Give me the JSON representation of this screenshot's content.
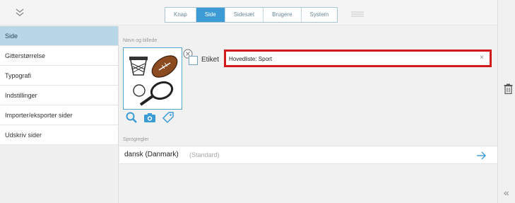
{
  "tabs": [
    "Knap",
    "Side",
    "Sidesæt",
    "Brugere",
    "System"
  ],
  "active_tab": "Side",
  "sidebar": {
    "items": [
      "Side",
      "Gitterstørrelse",
      "Typografi",
      "Indstillinger",
      "Importer/eksporter sider",
      "Udskriv sider"
    ],
    "active": "Side"
  },
  "main": {
    "name_image_label": "Navn og billede",
    "checkbox_label": "Etiket",
    "name_value": "Hovedliste: Sport",
    "language_label": "Sprogregler",
    "language_name": "dansk (Danmark)",
    "language_default": "(Standard)"
  },
  "icons": {
    "collapse": "double-chevron-down-icon",
    "menu": "menu-icon",
    "close": "circle-close-icon",
    "search": "search-icon",
    "camera": "camera-icon",
    "tag": "tag-icon",
    "arrow": "arrow-right-icon",
    "trash": "trash-icon",
    "panel_chevron": "double-chevron-left-icon"
  },
  "colors": {
    "accent": "#3c9bd4",
    "highlight": "#d11a1a",
    "sidebar_active": "#b7d7e6"
  }
}
